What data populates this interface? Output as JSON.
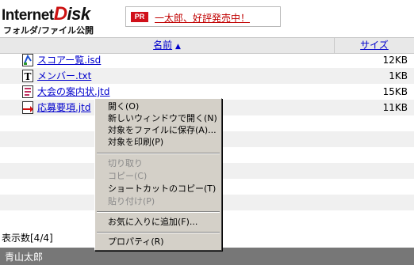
{
  "header": {
    "logo_internet": "Internet",
    "logo_disk_d": "D",
    "logo_disk_rest": "isk",
    "logo_sub": "フォルダ/ファイル公開",
    "pr_badge": "PR",
    "pr_link": "一太郎、好評発売中！"
  },
  "columns": {
    "name": "名前",
    "name_sort_icon": "triangle-up",
    "size": "サイズ"
  },
  "files": [
    {
      "name": "スコアー覧.isd",
      "size": "12KB",
      "icon": "score-file-icon"
    },
    {
      "name": "メンバー.txt",
      "size": "1KB",
      "icon": "text-file-icon"
    },
    {
      "name": "大会の案内状.jtd",
      "size": "15KB",
      "icon": "jtd-file-icon"
    },
    {
      "name": "応募要項.jtd",
      "size": "11KB",
      "icon": "red-arrow-file-icon"
    }
  ],
  "status": "表示数[4/4]",
  "footer": {
    "user": "青山太郎"
  },
  "context_menu": {
    "open": "開く(O)",
    "open_new_window": "新しいウィンドウで開く(N)",
    "save_target": "対象をファイルに保存(A)...",
    "print_target": "対象を印刷(P)",
    "cut": "切り取り",
    "copy": "コピー(C)",
    "copy_shortcut": "ショートカットのコピー(T)",
    "paste": "貼り付け(P)",
    "add_favorites": "お気に入りに追加(F)...",
    "properties": "プロパティ(R)"
  },
  "colors": {
    "link": "#0000cc",
    "pr_red": "#d0101a",
    "footer_bg": "#777777",
    "menu_bg": "#d4d0c8"
  }
}
